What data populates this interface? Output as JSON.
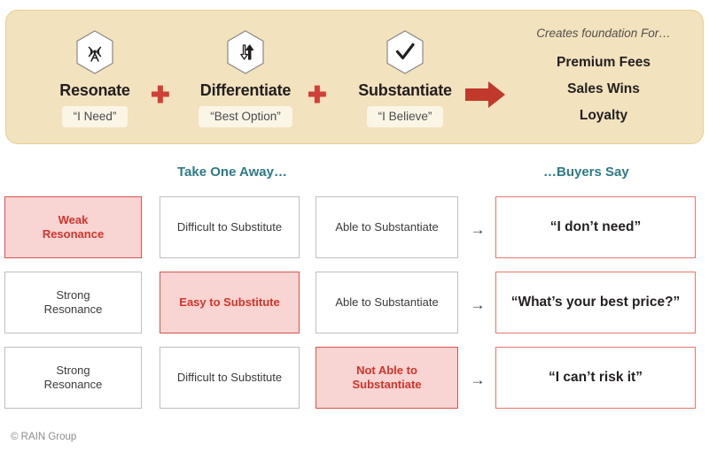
{
  "banner": {
    "pillars": [
      {
        "icon": "broadcast-tower-icon",
        "title": "Resonate",
        "pill": "“I Need”"
      },
      {
        "icon": "up-down-arrows-icon",
        "title": "Differentiate",
        "pill": "“Best Option”"
      },
      {
        "icon": "checkmark-icon",
        "title": "Substantiate",
        "pill": "“I Believe”"
      }
    ],
    "plus_symbol": "✚",
    "arrow_icon": "right-arrow-icon",
    "outcomes_caption": "Creates foundation For…",
    "outcomes": [
      "Premium Fees",
      "Sales Wins",
      "Loyalty"
    ]
  },
  "headings": {
    "take_one_away": "Take One Away…",
    "buyers_say": "…Buyers Say"
  },
  "matrix": {
    "row_arrow": "→",
    "rows": [
      {
        "resonance": {
          "text": "Weak\nResonance",
          "highlight": true
        },
        "substitute": {
          "text": "Difficult to Substitute",
          "highlight": false
        },
        "substantiate": {
          "text": "Able to Substantiate",
          "highlight": false
        },
        "outcome": {
          "text": "“I don’t need”"
        }
      },
      {
        "resonance": {
          "text": "Strong\nResonance",
          "highlight": false
        },
        "substitute": {
          "text": "Easy to Substitute",
          "highlight": true
        },
        "substantiate": {
          "text": "Able to Substantiate",
          "highlight": false
        },
        "outcome": {
          "text": "“What’s your best price?”"
        }
      },
      {
        "resonance": {
          "text": "Strong\nResonance",
          "highlight": false
        },
        "substitute": {
          "text": "Difficult to Substitute",
          "highlight": false
        },
        "substantiate": {
          "text": "Not Able to\nSubstantiate",
          "highlight": true
        },
        "outcome": {
          "text": "“I can’t risk it”"
        }
      }
    ]
  },
  "footer": {
    "copyright": "© RAIN Group"
  },
  "colors": {
    "banner_bg": "#f2e2bd",
    "pill_bg": "#fbf5e6",
    "accent_red": "#cf4037",
    "highlight_bg": "#f8d4d2",
    "highlight_text": "#d0342c",
    "outcome_border": "#e8756c",
    "heading_teal": "#2c7a86",
    "cell_border": "#bfbfbf"
  }
}
